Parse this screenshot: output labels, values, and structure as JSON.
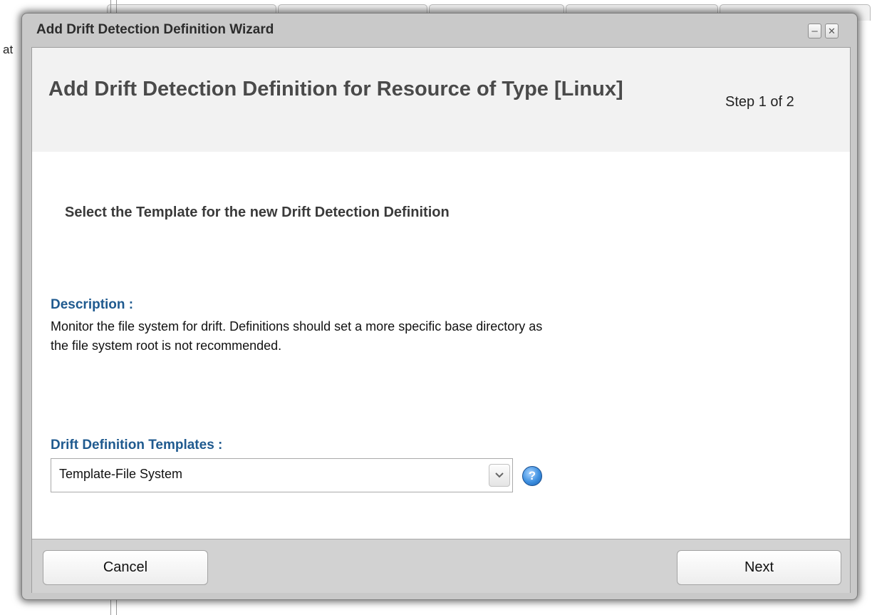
{
  "background": {
    "edge_text": "at"
  },
  "window": {
    "title": "Add Drift Detection Definition Wizard",
    "minimize_glyph": "–",
    "close_glyph": "✕"
  },
  "header": {
    "title": "Add Drift Detection Definition for Resource of Type [Linux]",
    "step": "Step 1 of 2"
  },
  "body": {
    "section_heading": "Select the Template for the new Drift Detection Definition",
    "description_label": "Description :",
    "description_text": "Monitor the file system for drift. Definitions should set a more specific base directory as the file system root is not recommended.",
    "templates_label": "Drift Definition Templates :",
    "templates_selected": "Template-File System",
    "help_glyph": "?"
  },
  "footer": {
    "cancel_label": "Cancel",
    "next_label": "Next"
  }
}
